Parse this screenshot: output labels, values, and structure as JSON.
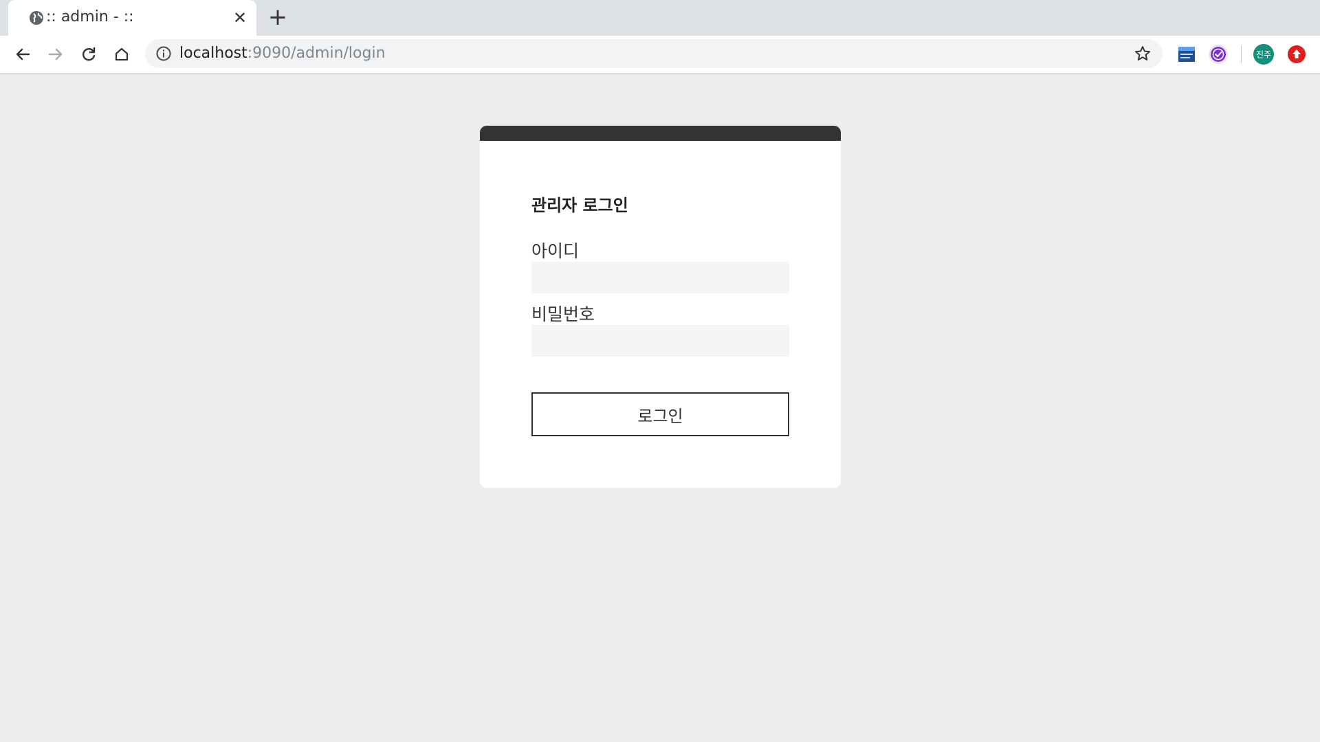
{
  "browser": {
    "tab": {
      "title": ":: admin - ::",
      "favicon": "globe-icon"
    },
    "address": {
      "host": "localhost",
      "rest": ":9090/admin/login"
    },
    "extensions": [
      {
        "name": "naver-dictionary-extension-icon"
      },
      {
        "name": "purple-check-extension-icon",
        "color": "#7b2fd6"
      },
      {
        "name": "profile-avatar",
        "label": "진주",
        "color": "#138f7b"
      },
      {
        "name": "red-upload-extension-icon",
        "color": "#e01d1d"
      }
    ]
  },
  "login": {
    "title": "관리자 로그인",
    "id_label": "아이디",
    "id_value": "",
    "password_label": "비밀번호",
    "password_value": "",
    "submit_label": "로그인"
  },
  "colors": {
    "page_background": "#ededed",
    "card_header": "#333333",
    "input_background": "#f4f4f4"
  }
}
